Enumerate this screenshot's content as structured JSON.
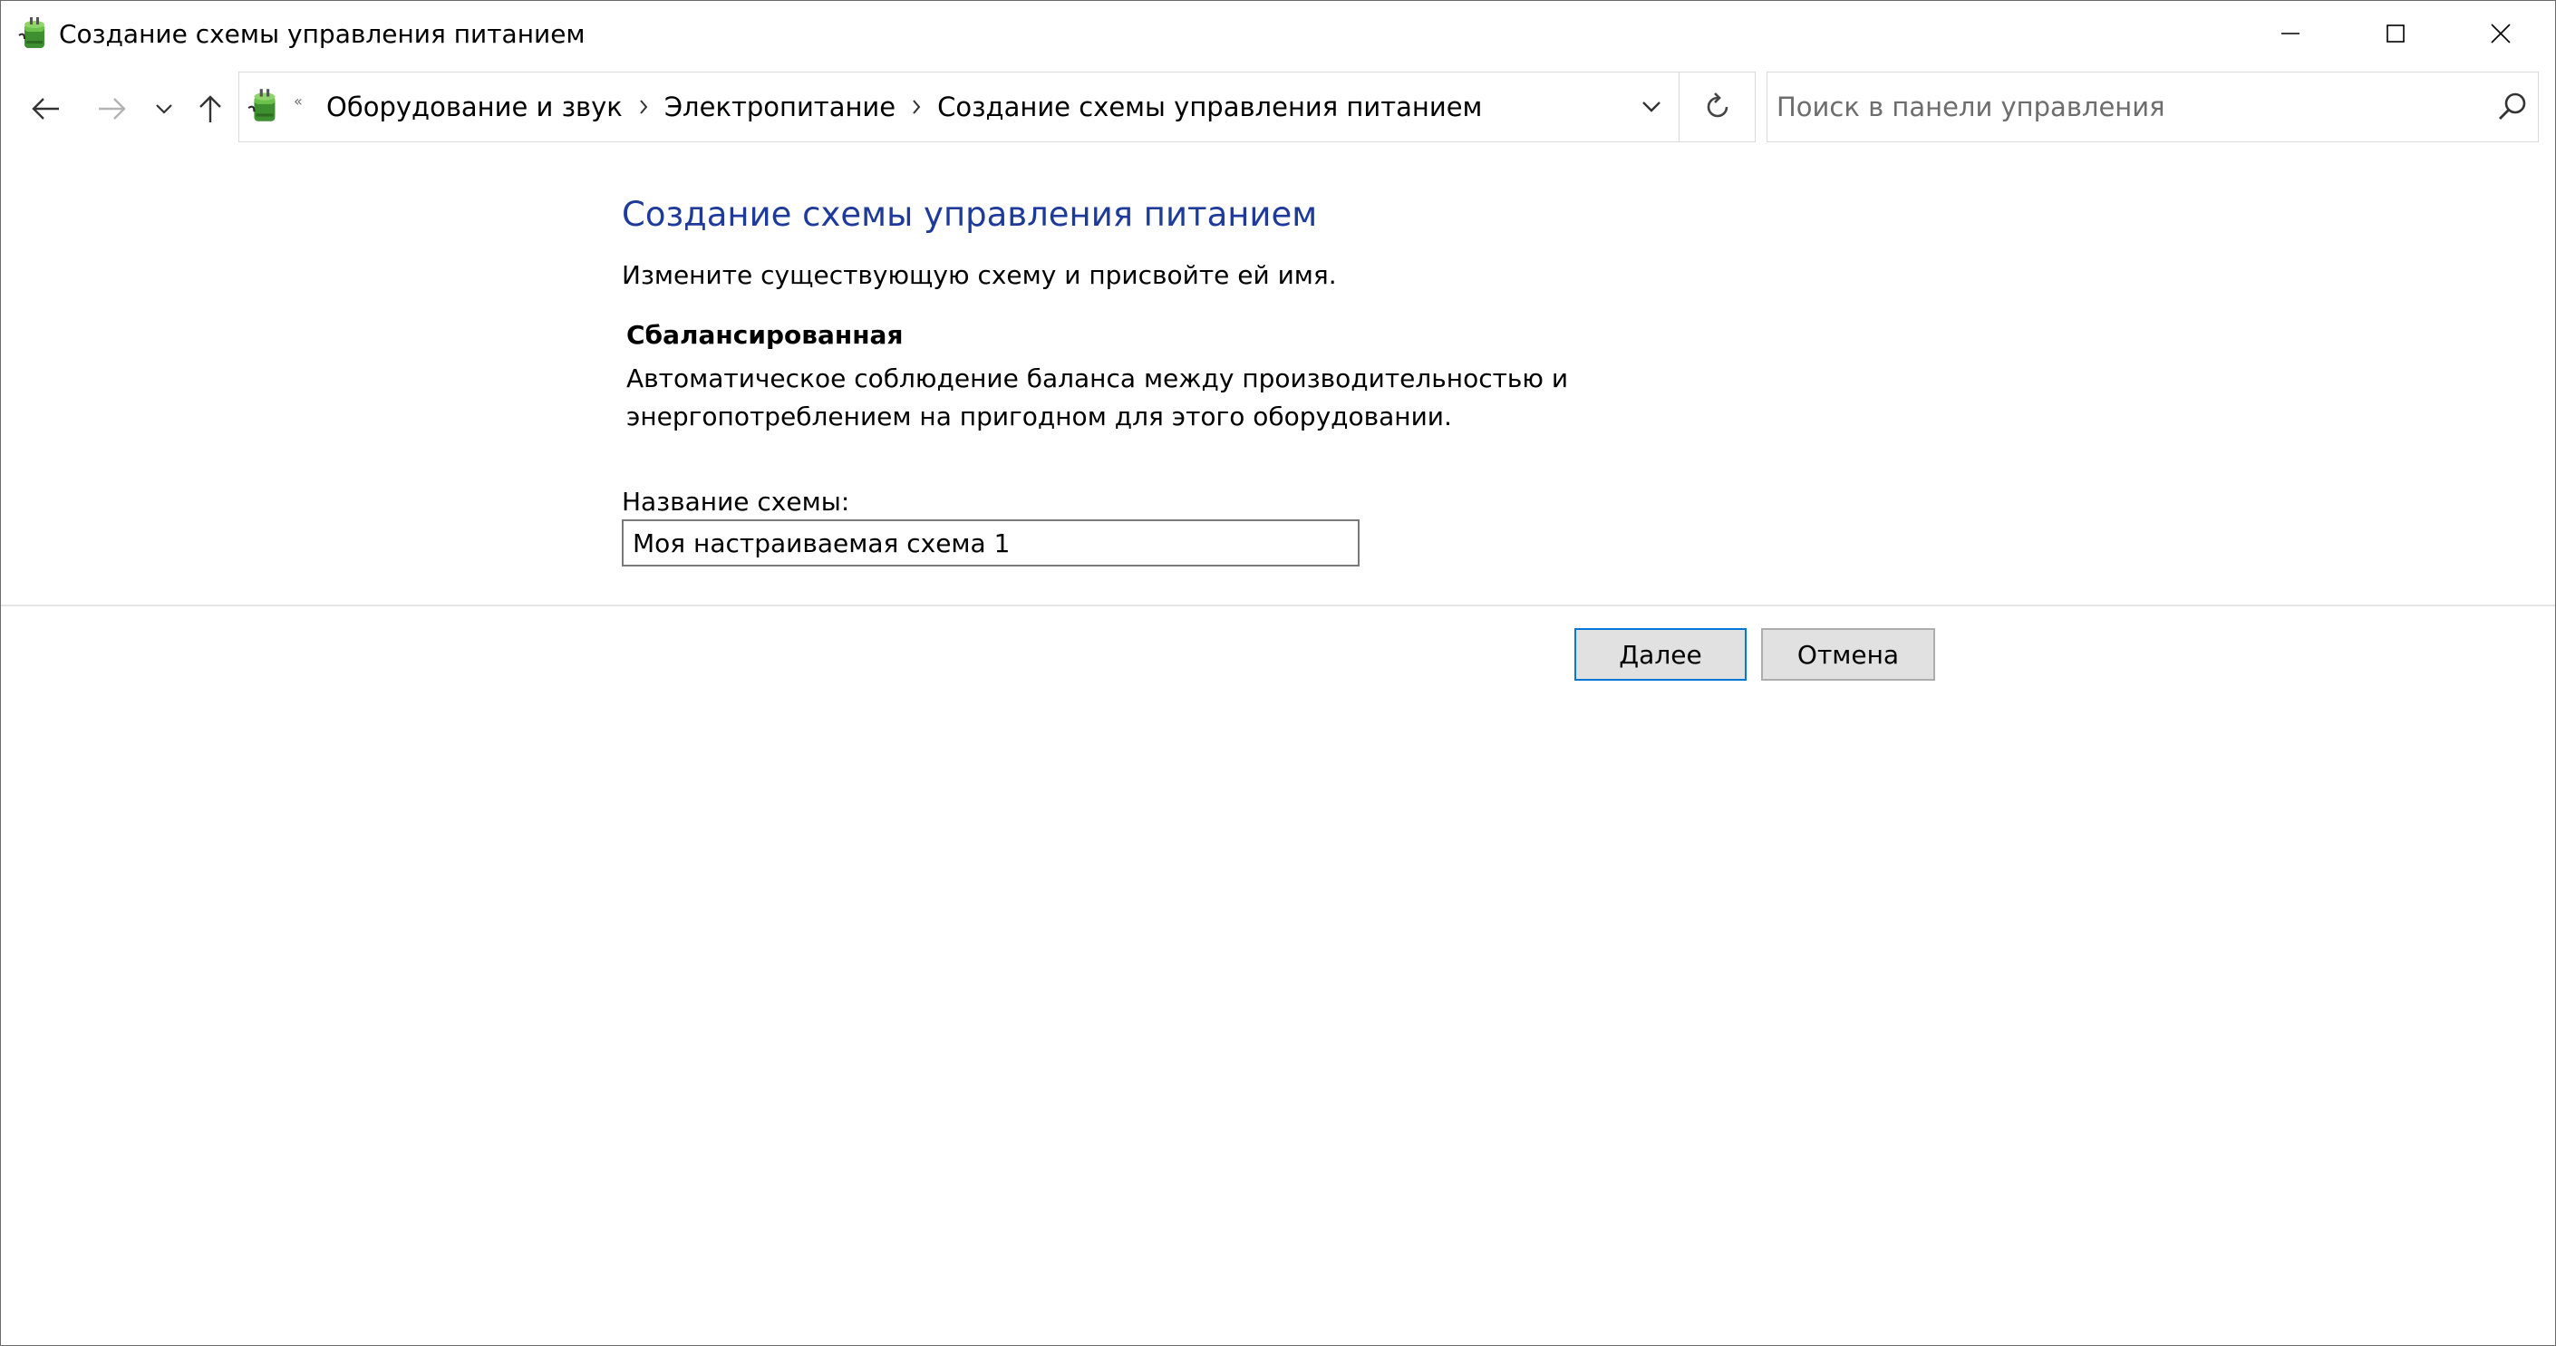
{
  "window": {
    "title": "Создание схемы управления питанием"
  },
  "navigation": {
    "breadcrumbs": [
      {
        "label": "Оборудование и звук"
      },
      {
        "label": "Электропитание"
      },
      {
        "label": "Создание схемы управления питанием"
      }
    ],
    "overflow_indicator": "«"
  },
  "search": {
    "placeholder": "Поиск в панели управления",
    "value": ""
  },
  "main": {
    "title": "Создание схемы управления питанием",
    "subtitle": "Измените существующую схему и присвойте ей имя.",
    "plan": {
      "name": "Сбалансированная",
      "description": "Автоматическое соблюдение баланса между производительностью и энергопотреблением на пригодном для этого оборудовании."
    },
    "scheme_name": {
      "label": "Название схемы:",
      "value": "Моя настраиваемая схема 1"
    },
    "buttons": {
      "next": "Далее",
      "cancel": "Отмена"
    }
  },
  "colors": {
    "title_blue": "#1e3a9a",
    "focus_blue": "#0078d7"
  },
  "icons": {
    "app": "power-options-icon",
    "back": "arrow-left-icon",
    "forward": "arrow-right-icon",
    "recent": "chevron-down-icon",
    "up": "arrow-up-icon",
    "refresh": "refresh-icon",
    "search": "search-icon"
  }
}
